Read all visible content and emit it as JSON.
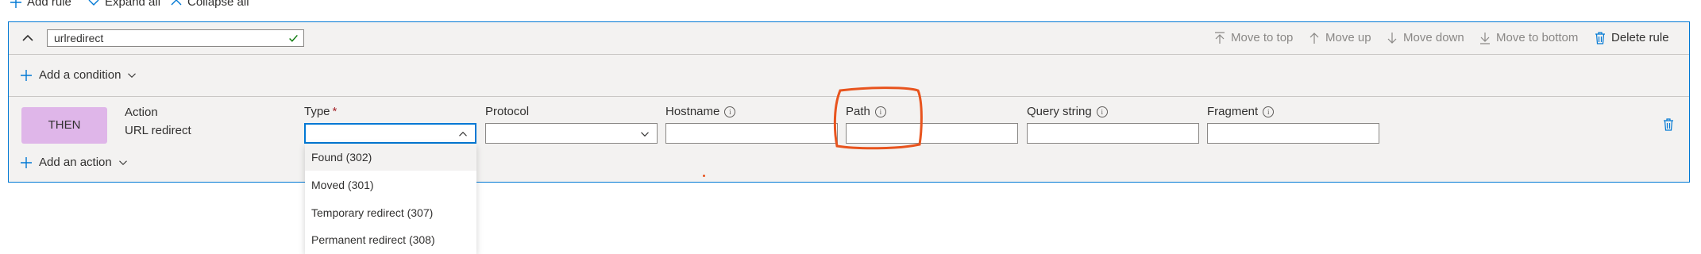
{
  "toolbar": {
    "add_rule": "Add rule",
    "expand_all": "Expand all",
    "collapse_all": "Collapse all"
  },
  "rule": {
    "name_value": "urlredirect",
    "actions": {
      "move_to_top": "Move to top",
      "move_up": "Move up",
      "move_down": "Move down",
      "move_to_bottom": "Move to bottom",
      "delete_rule": "Delete rule"
    },
    "add_condition": "Add a condition",
    "then_label": "THEN",
    "action_label": "Action",
    "action_value": "URL redirect",
    "add_action": "Add an action",
    "fields": {
      "type": "Type",
      "type_required": "*",
      "protocol": "Protocol",
      "hostname": "Hostname",
      "path": "Path",
      "query_string": "Query string",
      "fragment": "Fragment"
    },
    "type_options": [
      "Found (302)",
      "Moved (301)",
      "Temporary redirect (307)",
      "Permanent redirect (308)"
    ]
  },
  "colors": {
    "accent": "#0078d4",
    "then_badge": "#dfb6e9",
    "highlight": "#e8541e",
    "valid_check": "#107c10"
  }
}
